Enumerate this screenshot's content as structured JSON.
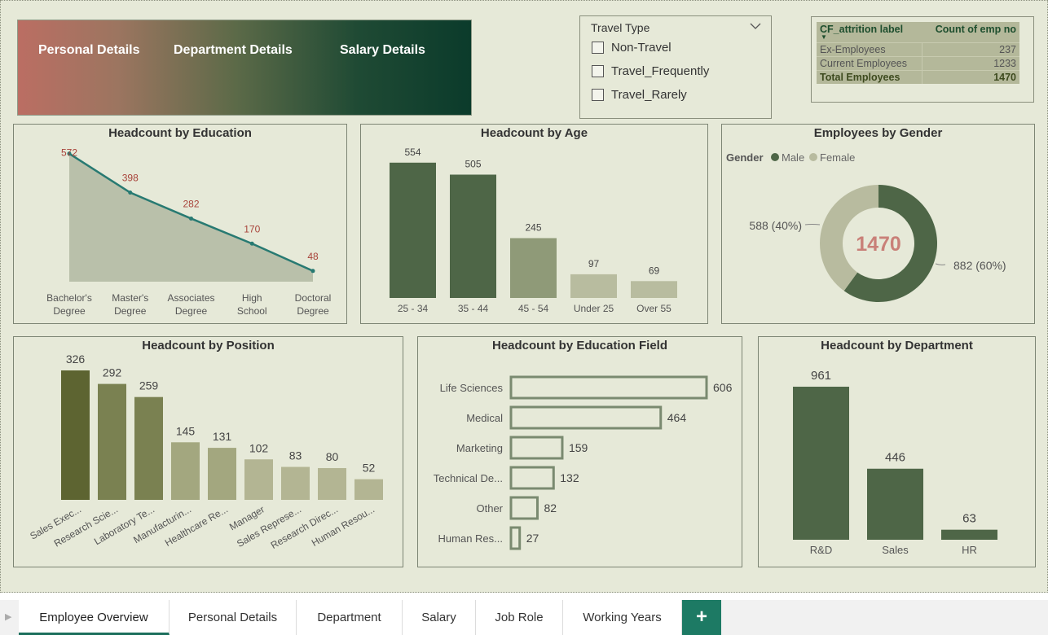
{
  "banner": {
    "nav": [
      "Personal Details",
      "Department Details",
      "Salary Details"
    ]
  },
  "slicer": {
    "title": "Travel Type",
    "options": [
      "Non-Travel",
      "Travel_Frequently",
      "Travel_Rarely"
    ]
  },
  "kpi_table": {
    "headers": [
      "CF_attrition label",
      "Count of emp no"
    ],
    "rows": [
      {
        "label": "Ex-Employees",
        "value": "237"
      },
      {
        "label": "Current Employees",
        "value": "1233"
      },
      {
        "label": "Total Employees",
        "value": "1470"
      }
    ]
  },
  "colors": {
    "dark_green": "#4e6647",
    "mid_green": "#8f9a78",
    "light_green": "#b8bc9f",
    "olive": "#5d6431",
    "olive2": "#7a8151",
    "olive_light": "#a3a77f",
    "olive_pale": "#b3b593",
    "teal_line": "#287a72",
    "area_fill": "#b9c0aa",
    "label_red": "#a8433a",
    "donut_male": "#4e6647",
    "donut_female": "#b8bb9f",
    "donut_center": "#c98078",
    "accent_tab": "#1d7a64"
  },
  "chart_data": [
    {
      "type": "area",
      "title": "Headcount by Education",
      "categories": [
        "Bachelor's Degree",
        "Master's Degree",
        "Associates Degree",
        "High School",
        "Doctoral Degree"
      ],
      "category_lines": [
        [
          "Bachelor's",
          "Degree"
        ],
        [
          "Master's",
          "Degree"
        ],
        [
          "Associates",
          "Degree"
        ],
        [
          "High",
          "School"
        ],
        [
          "Doctoral",
          "Degree"
        ]
      ],
      "values": [
        572,
        398,
        282,
        170,
        48
      ],
      "ylim": [
        0,
        600
      ]
    },
    {
      "type": "bar",
      "title": "Headcount by Age",
      "categories": [
        "25 - 34",
        "35 - 44",
        "45 - 54",
        "Under 25",
        "Over 55"
      ],
      "values": [
        554,
        505,
        245,
        97,
        69
      ],
      "ylim": [
        0,
        600
      ]
    },
    {
      "type": "pie",
      "title": "Employees by Gender",
      "legend_title": "Gender",
      "center_label": "1470",
      "slices": [
        {
          "name": "Male",
          "value": 882,
          "label": "882 (60%)"
        },
        {
          "name": "Female",
          "value": 588,
          "label": "588 (40%)"
        }
      ]
    },
    {
      "type": "bar",
      "title": "Headcount by Position",
      "categories": [
        "Sales Exec...",
        "Research Scie...",
        "Laboratory Te...",
        "Manufacturin...",
        "Healthcare Re...",
        "Manager",
        "Sales Represe...",
        "Research Direc...",
        "Human Resou..."
      ],
      "values": [
        326,
        292,
        259,
        145,
        131,
        102,
        83,
        80,
        52
      ],
      "ylim": [
        0,
        360
      ]
    },
    {
      "type": "bar",
      "orientation": "horizontal",
      "title": "Headcount by Education Field",
      "categories": [
        "Life Sciences",
        "Medical",
        "Marketing",
        "Technical De...",
        "Other",
        "Human Res..."
      ],
      "values": [
        606,
        464,
        159,
        132,
        82,
        27
      ],
      "xlim": [
        0,
        620
      ]
    },
    {
      "type": "bar",
      "title": "Headcount by Department",
      "categories": [
        "R&D",
        "Sales",
        "HR"
      ],
      "values": [
        961,
        446,
        63
      ],
      "ylim": [
        0,
        1000
      ]
    }
  ],
  "tabs": [
    "Employee Overview",
    "Personal Details",
    "Department",
    "Salary",
    "Job Role",
    "Working Years"
  ],
  "add_tab_label": "+"
}
